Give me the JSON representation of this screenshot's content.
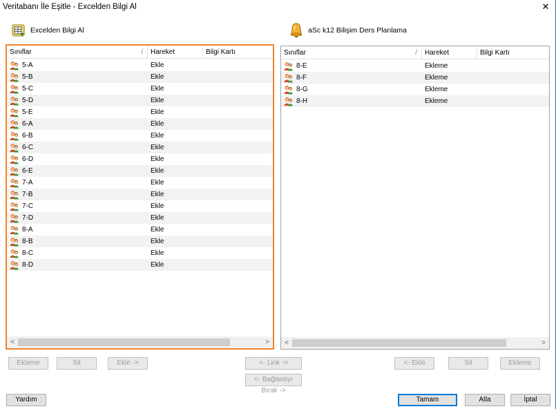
{
  "window": {
    "title": "Veritabanı İle Eşitle - Excelden Bilgi Al",
    "close_glyph": "✕"
  },
  "left_section": {
    "icon": "excel-import-icon",
    "title": "Excelden Bilgi Al"
  },
  "right_section": {
    "icon": "bell-icon",
    "title": "aSc k12 Bilişim Ders Planlama"
  },
  "columns": [
    "Sınıflar",
    "Hareket",
    "Bilgi Kartı"
  ],
  "sort_mark": "/",
  "left_rows": [
    {
      "name": "5-A",
      "action": "Ekle"
    },
    {
      "name": "5-B",
      "action": "Ekle"
    },
    {
      "name": "5-C",
      "action": "Ekle"
    },
    {
      "name": "5-D",
      "action": "Ekle"
    },
    {
      "name": "5-E",
      "action": "Ekle"
    },
    {
      "name": "6-A",
      "action": "Ekle"
    },
    {
      "name": "6-B",
      "action": "Ekle"
    },
    {
      "name": "6-C",
      "action": "Ekle"
    },
    {
      "name": "6-D",
      "action": "Ekle"
    },
    {
      "name": "6-E",
      "action": "Ekle"
    },
    {
      "name": "7-A",
      "action": "Ekle"
    },
    {
      "name": "7-B",
      "action": "Ekle"
    },
    {
      "name": "7-C",
      "action": "Ekle"
    },
    {
      "name": "7-D",
      "action": "Ekle"
    },
    {
      "name": "8-A",
      "action": "Ekle"
    },
    {
      "name": "8-B",
      "action": "Ekle"
    },
    {
      "name": "8-C",
      "action": "Ekle"
    },
    {
      "name": "8-D",
      "action": "Ekle"
    }
  ],
  "right_rows": [
    {
      "name": "8-E",
      "action": "Ekleme"
    },
    {
      "name": "8-F",
      "action": "Ekleme"
    },
    {
      "name": "8-G",
      "action": "Ekleme"
    },
    {
      "name": "8-H",
      "action": "Ekleme"
    }
  ],
  "row_icon": "class-users-icon",
  "scroll": {
    "left_arrow": "<",
    "right_arrow": ">"
  },
  "buttons": {
    "left_ekleme": "Ekleme",
    "left_sil": "Sil",
    "left_ekle_right": "Ekle ->",
    "link": "<- Link ->",
    "unlink": "<- Bağlantıyı Bırak ->",
    "right_ekle_left": "<- Ekle",
    "right_sil": "Sil",
    "right_ekleme": "Ekleme",
    "help": "Yardım",
    "ok": "Tamam",
    "skip": "Atla",
    "cancel": "İptal"
  },
  "colors": {
    "focus_border": "#f0822b",
    "primary_border": "#0078d7"
  }
}
